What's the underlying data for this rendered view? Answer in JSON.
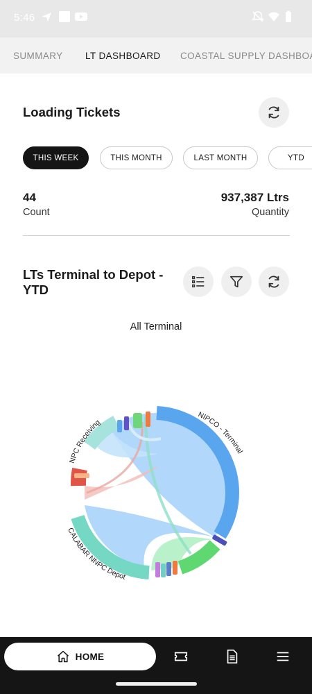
{
  "status_bar": {
    "time": "5:46",
    "left_icons": [
      "navigation-arrow-icon",
      "square-app-icon",
      "youtube-icon"
    ],
    "right_icons": [
      "mute-icon",
      "wifi-icon",
      "battery-icon"
    ]
  },
  "tabs": [
    {
      "label": "SUMMARY",
      "active": false
    },
    {
      "label": "LT DASHBOARD",
      "active": true
    },
    {
      "label": "COASTAL SUPPLY DASHBOARD",
      "active": false
    }
  ],
  "loading_tickets": {
    "title": "Loading Tickets",
    "filters": [
      {
        "label": "THIS WEEK",
        "active": true
      },
      {
        "label": "THIS MONTH",
        "active": false
      },
      {
        "label": "LAST MONTH",
        "active": false
      },
      {
        "label": "YTD",
        "active": false
      }
    ],
    "count_value": "44",
    "count_label": "Count",
    "quantity_value": "937,387 Ltrs",
    "quantity_label": "Quantity"
  },
  "terminal_chart": {
    "title_line1": "LTs Terminal to Depot -",
    "title_line2": "YTD",
    "subtitle": "All Terminal",
    "arc_labels": {
      "nipco": "NIPCO - Terminal",
      "npc": "NPC Receiving",
      "calabar": "CALABAR NNPC Depot"
    }
  },
  "chart_data": {
    "type": "chord",
    "title": "LTs Terminal to Depot - YTD",
    "subtitle": "All Terminal",
    "groups": [
      "NIPCO - Terminal",
      "NPC Receiving",
      "CALABAR NNPC Depot"
    ],
    "colors": {
      "nipco": "#5aa6ee",
      "npc": "#a6e3dc",
      "calabar": "#74d8c4",
      "red_group": "#e05548",
      "green_group": "#5fd872",
      "chord_fill": "#a9d3fa"
    }
  },
  "bottom_nav": {
    "home_label": "HOME",
    "icons": [
      "home-icon",
      "ticket-icon",
      "document-icon",
      "menu-icon"
    ]
  }
}
